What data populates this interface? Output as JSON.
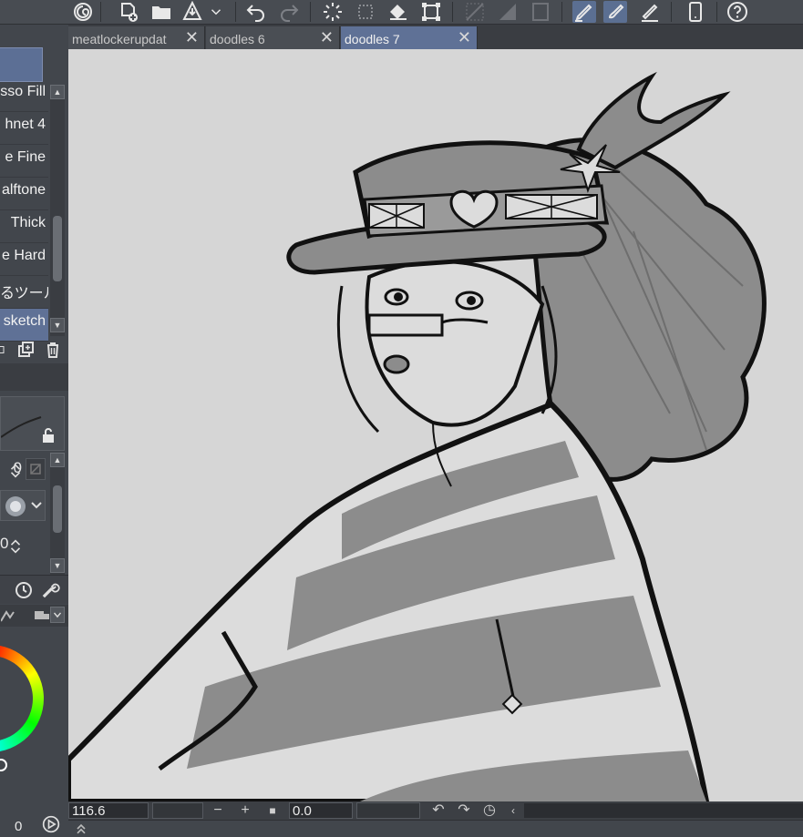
{
  "tabs": [
    {
      "label": "meatlockerupdat",
      "active": false
    },
    {
      "label": "doodles 6",
      "active": false
    },
    {
      "label": "doodles 7",
      "active": true
    }
  ],
  "tab_close_glyph": "✕",
  "tools": [
    {
      "label": "sso Fill"
    },
    {
      "label": "hnet 4"
    },
    {
      "label": "e Fine"
    },
    {
      "label": "alftone"
    },
    {
      "label": "Thick"
    },
    {
      "label": "e Hard"
    },
    {
      "label": "るツール"
    },
    {
      "label": "sketch",
      "selected": true
    }
  ],
  "brush": {
    "size_partial": "0",
    "opacity_partial": "0"
  },
  "color_wheel": {
    "value": "0"
  },
  "status": {
    "zoom": "116.6",
    "rotation": "0.0"
  },
  "colors": {
    "accent": "#5f7196",
    "canvas": "#d6d6d6",
    "panel": "#42464c"
  }
}
